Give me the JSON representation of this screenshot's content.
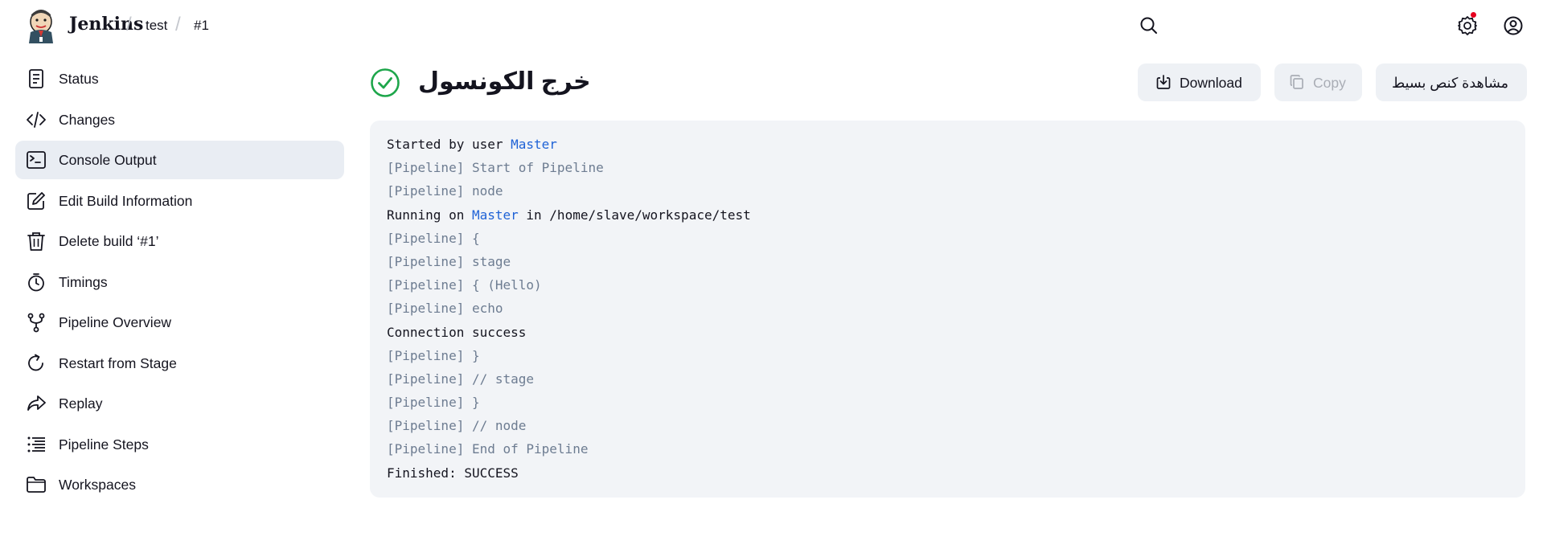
{
  "header": {
    "brand": "Jenkins",
    "breadcrumbs": [
      "test",
      "#1"
    ],
    "icons": [
      "search-icon",
      "settings-icon",
      "account-icon"
    ],
    "notification_color": "#e6001f"
  },
  "sidebar": {
    "items": [
      {
        "label": "Status",
        "icon": "status-icon"
      },
      {
        "label": "Changes",
        "icon": "code-icon"
      },
      {
        "label": "Console Output",
        "icon": "terminal-icon",
        "active": true
      },
      {
        "label": "Edit Build Information",
        "icon": "edit-icon"
      },
      {
        "label": "Delete build ‘#1’",
        "icon": "trash-icon"
      },
      {
        "label": "Timings",
        "icon": "stopwatch-icon"
      },
      {
        "label": "Pipeline Overview",
        "icon": "branch-icon"
      },
      {
        "label": "Restart from Stage",
        "icon": "restart-icon"
      },
      {
        "label": "Replay",
        "icon": "replay-icon"
      },
      {
        "label": "Pipeline Steps",
        "icon": "list-icon"
      },
      {
        "label": "Workspaces",
        "icon": "folder-icon"
      }
    ]
  },
  "main": {
    "title": "خرج الكونسول",
    "status_icon": "success-check-icon",
    "status_color": "#1ea64b",
    "buttons": {
      "download": "Download",
      "copy": "Copy",
      "plain_text": "مشاهدة كنص بسيط"
    }
  },
  "console": {
    "link_color": "#1f62d6",
    "lines": {
      "l1_pre": "Started by user ",
      "l1_link": "Master",
      "l2": "[Pipeline] Start of Pipeline",
      "l3": "[Pipeline] node",
      "l4_pre": "Running on ",
      "l4_link": "Master",
      "l4_post": " in /home/slave/workspace/test",
      "l5": "[Pipeline] {",
      "l6": "[Pipeline] stage",
      "l7": "[Pipeline] { (Hello)",
      "l8": "[Pipeline] echo",
      "l9": "Connection success",
      "l10": "[Pipeline] }",
      "l11": "[Pipeline] // stage",
      "l12": "[Pipeline] }",
      "l13": "[Pipeline] // node",
      "l14": "[Pipeline] End of Pipeline",
      "l15": "Finished: SUCCESS"
    }
  }
}
